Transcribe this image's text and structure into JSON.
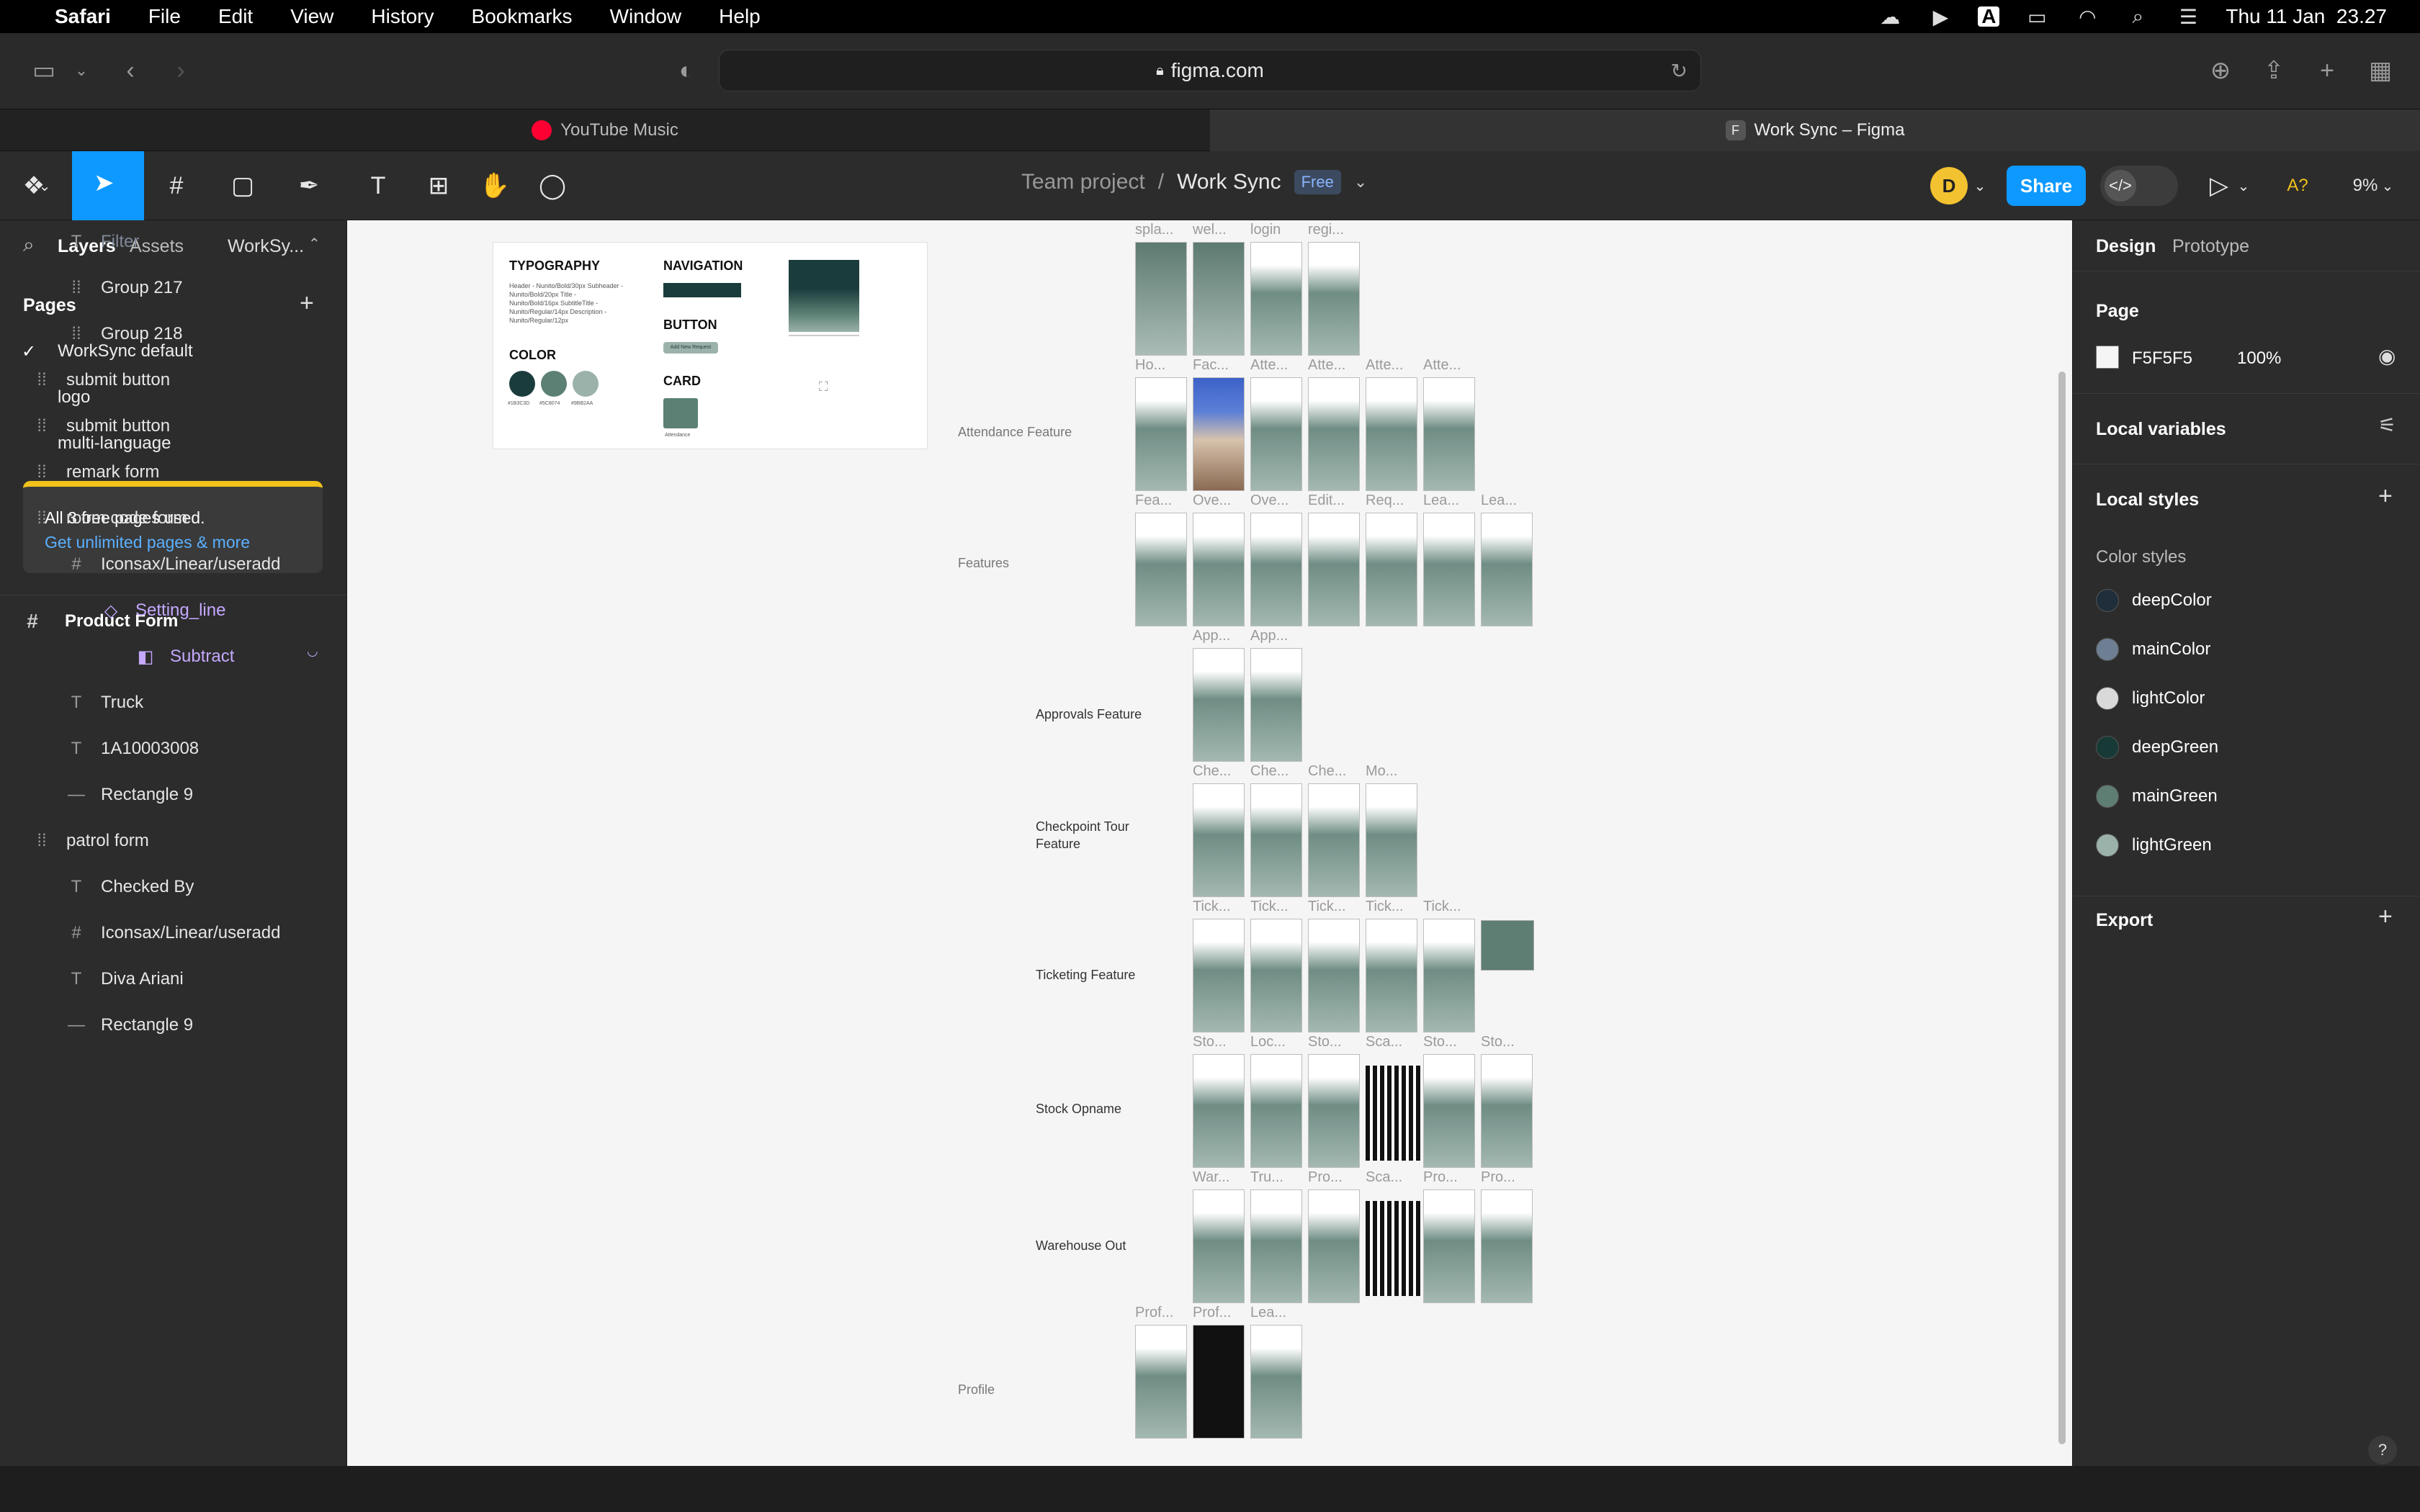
{
  "menubar": {
    "app": "Safari",
    "items": [
      "File",
      "Edit",
      "View",
      "History",
      "Bookmarks",
      "Window",
      "Help"
    ],
    "clock": "Thu 11 Jan  23.27"
  },
  "browser": {
    "url": "figma.com",
    "tabs": [
      {
        "label": "YouTube Music",
        "active": false
      },
      {
        "label": "Work Sync – Figma",
        "active": true
      }
    ]
  },
  "figma_toolbar": {
    "project": "Team project",
    "separator": "/",
    "file": "Work Sync",
    "plan_badge": "Free",
    "avatar_initial": "D",
    "share_label": "Share",
    "a11y_label": "A?",
    "zoom": "9%"
  },
  "left_panel": {
    "tabs": [
      "Layers",
      "Assets",
      "WorkSy..."
    ],
    "pages_header": "Pages",
    "pages": [
      {
        "label": "WorkSync default",
        "current": true
      },
      {
        "label": "logo",
        "current": false
      },
      {
        "label": "multi-language",
        "current": false
      }
    ],
    "notice_text": "All 3 free pages used.",
    "notice_link": "Get unlimited pages & more",
    "frame_title": "Product Form",
    "layers": [
      {
        "label": "Filter",
        "icon": "text",
        "indent": 2,
        "type": "text"
      },
      {
        "label": "Group 217",
        "icon": "group",
        "indent": 2,
        "type": "normal"
      },
      {
        "label": "Group 218",
        "icon": "group",
        "indent": 2,
        "type": "normal"
      },
      {
        "label": "submit button",
        "icon": "group",
        "indent": 1,
        "type": "normal"
      },
      {
        "label": "submit button",
        "icon": "group",
        "indent": 1,
        "type": "normal"
      },
      {
        "label": "remark form",
        "icon": "group",
        "indent": 1,
        "type": "normal"
      },
      {
        "label": "room code form",
        "icon": "group",
        "indent": 1,
        "type": "normal"
      },
      {
        "label": "Iconsax/Linear/useradd",
        "icon": "frame",
        "indent": 2,
        "type": "normal"
      },
      {
        "label": "Setting_line",
        "icon": "component",
        "indent": 3,
        "type": "purple"
      },
      {
        "label": "Subtract",
        "icon": "boolean",
        "indent": 4,
        "type": "purple"
      },
      {
        "label": "Truck",
        "icon": "text",
        "indent": 2,
        "type": "normal"
      },
      {
        "label": "1A10003008",
        "icon": "text",
        "indent": 2,
        "type": "normal"
      },
      {
        "label": "Rectangle 9",
        "icon": "line",
        "indent": 2,
        "type": "normal"
      },
      {
        "label": "patrol form",
        "icon": "group",
        "indent": 1,
        "type": "normal"
      },
      {
        "label": "Checked By",
        "icon": "text",
        "indent": 2,
        "type": "normal"
      },
      {
        "label": "Iconsax/Linear/useradd",
        "icon": "frame",
        "indent": 2,
        "type": "normal"
      },
      {
        "label": "Diva Ariani",
        "icon": "text",
        "indent": 2,
        "type": "normal"
      },
      {
        "label": "Rectangle 9",
        "icon": "line",
        "indent": 2,
        "type": "normal"
      }
    ]
  },
  "right_panel": {
    "tabs": [
      "Design",
      "Prototype"
    ],
    "page_header": "Page",
    "page_color": "F5F5F5",
    "page_opacity": "100%",
    "local_variables": "Local variables",
    "local_styles": "Local styles",
    "color_styles_header": "Color styles",
    "color_styles": [
      {
        "name": "deepColor",
        "color": "#1f2e3a"
      },
      {
        "name": "mainColor",
        "color": "#6e7f93"
      },
      {
        "name": "lightColor",
        "color": "#d9d9d9"
      },
      {
        "name": "deepGreen",
        "color": "#173a36"
      },
      {
        "name": "mainGreen",
        "color": "#5e7d73"
      },
      {
        "name": "lightGreen",
        "color": "#9bb2aa"
      }
    ],
    "export": "Export"
  },
  "canvas": {
    "background": "#F5F5F5",
    "styleguide": {
      "typography": "TYPOGRAPHY",
      "typography_lines": "Header - Nunito/Bold/30px Subheader - Nunito/Bold/20px Title - Nunito/Bold/16px SubtitleTitle - Nunito/Regular/14px Description - Nunito/Regular/12px",
      "navigation": "NAVIGATION",
      "button": "BUTTON",
      "button_sample": "Add New Request",
      "color": "COLOR",
      "color_codes": [
        "#1B3C3D",
        "#5C8074",
        "#9BB2AA"
      ],
      "card": "CARD",
      "card_label": "Attendance"
    },
    "sections": [
      "Attendance Feature",
      "Features",
      "Approvals Feature",
      "Checkpoint Tour Feature",
      "Ticketing Feature",
      "Stock Opname",
      "Warehouse Out",
      "Profile"
    ],
    "frame_names": {
      "row1": [
        "spla...",
        "wel...",
        "login",
        "regi..."
      ],
      "row2": [
        "Ho...",
        "Fac...",
        "Atte...",
        "Atte...",
        "Atte...",
        "Atte..."
      ],
      "row3": [
        "Fea...",
        "Ove...",
        "Ove...",
        "Edit...",
        "Req...",
        "Lea...",
        "Lea..."
      ],
      "row4": [
        "App...",
        "App..."
      ],
      "row5": [
        "Che...",
        "Che...",
        "Che...",
        "Mo..."
      ],
      "row6": [
        "Tick...",
        "Tick...",
        "Tick...",
        "Tick...",
        "Tick..."
      ],
      "row7": [
        "Sto...",
        "Loc...",
        "Sto...",
        "Sca...",
        "Sto...",
        "Sto..."
      ],
      "row8": [
        "War...",
        "Tru...",
        "Pro...",
        "Sca...",
        "Pro...",
        "Pro..."
      ],
      "row9": [
        "Prof...",
        "Prof...",
        "Lea..."
      ]
    }
  }
}
